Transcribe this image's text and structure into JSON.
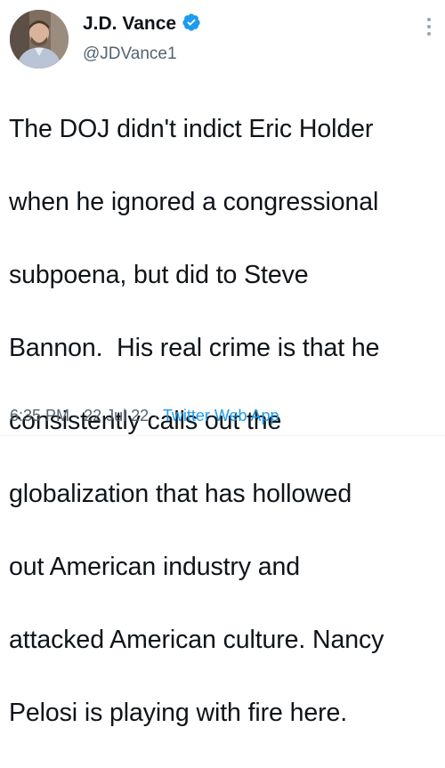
{
  "author": {
    "display_name": "J.D. Vance",
    "handle": "@JDVance1",
    "verified": true,
    "avatar_icon": "profile-photo"
  },
  "tweet": {
    "text_lines": [
      "The DOJ didn't indict Eric Holder",
      "when he ignored a congressional",
      "subpoena, but did to Steve",
      "Bannon.  His real crime is that he",
      "consistently calls out the",
      "globalization that has hollowed",
      "out American industry and",
      "attacked American culture. Nancy",
      "Pelosi is playing with fire here."
    ],
    "time": "6:35 PM",
    "separator": "·",
    "date": "22 Jul 22",
    "source": "Twitter Web App"
  },
  "icons": {
    "verified": "verified-badge-icon",
    "more": "more-options-icon"
  },
  "colors": {
    "accent": "#1d9bf0",
    "text": "#0f1419",
    "secondary": "#536471"
  }
}
